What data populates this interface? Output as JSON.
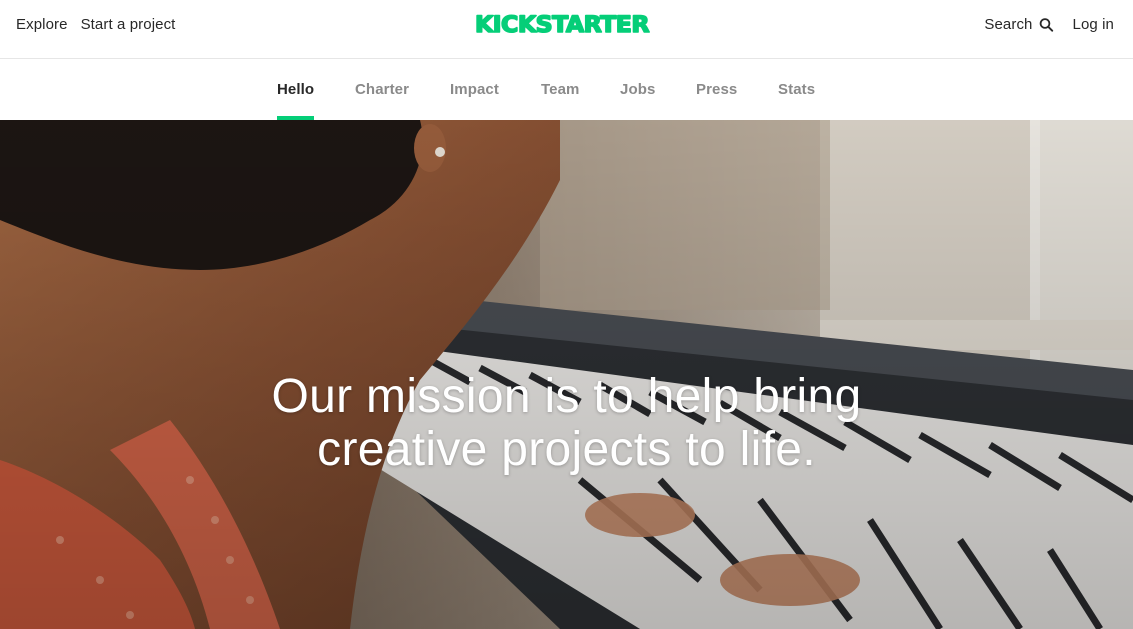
{
  "header": {
    "nav_left": [
      {
        "label": "Explore"
      },
      {
        "label": "Start a project"
      }
    ],
    "logo_text": "KICKSTARTER",
    "nav_right": {
      "search_label": "Search",
      "login_label": "Log in"
    }
  },
  "subnav": {
    "active_tab": "Hello",
    "tabs": [
      {
        "label": "Hello"
      },
      {
        "label": "Charter"
      },
      {
        "label": "Impact"
      },
      {
        "label": "Team"
      },
      {
        "label": "Jobs"
      },
      {
        "label": "Press"
      },
      {
        "label": "Stats"
      }
    ]
  },
  "hero": {
    "line1": "Our mission is to help bring",
    "line2": "creative projects to life."
  },
  "colors": {
    "brand_green": "#05ce78",
    "active_tab_text": "#282828",
    "inactive_tab_text": "#8a8a8a"
  }
}
